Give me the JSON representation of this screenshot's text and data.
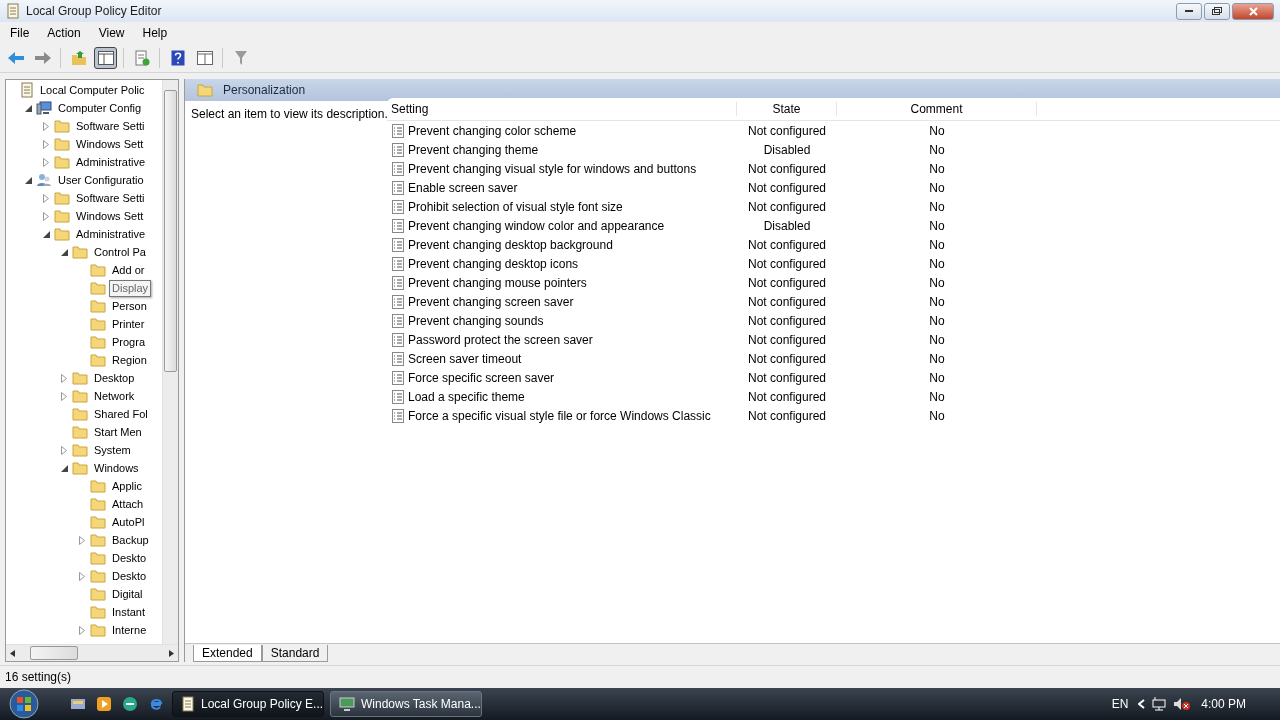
{
  "window": {
    "title": "Local Group Policy Editor"
  },
  "menu": [
    "File",
    "Action",
    "View",
    "Help"
  ],
  "toolbar": [
    [
      {
        "kind": "back",
        "pressed": false
      },
      {
        "kind": "forward",
        "pressed": false
      }
    ],
    [
      {
        "kind": "up",
        "pressed": false
      },
      {
        "kind": "tree",
        "pressed": true
      }
    ],
    [
      {
        "kind": "export",
        "pressed": false
      }
    ],
    [
      {
        "kind": "help",
        "pressed": false
      },
      {
        "kind": "view",
        "pressed": false
      }
    ],
    [
      {
        "kind": "filter",
        "pressed": false
      }
    ]
  ],
  "tree": [
    {
      "label": "Local Computer Polic",
      "kind": "root",
      "hovered": false,
      "children": [
        {
          "label": "Computer Config",
          "kind": "computer",
          "expanded": true,
          "hovered": false,
          "children": [
            {
              "label": "Software Setti",
              "kind": "folder",
              "expanded": false,
              "hovered": false
            },
            {
              "label": "Windows Sett",
              "kind": "folder",
              "expanded": false,
              "hovered": false
            },
            {
              "label": "Administrative",
              "kind": "folder",
              "expanded": false,
              "hovered": false
            }
          ]
        },
        {
          "label": "User Configuratio",
          "kind": "user",
          "expanded": true,
          "hovered": false,
          "children": [
            {
              "label": "Software Setti",
              "kind": "folder",
              "expanded": false,
              "hovered": false
            },
            {
              "label": "Windows Sett",
              "kind": "folder",
              "expanded": false,
              "hovered": false
            },
            {
              "label": "Administrative",
              "kind": "folder",
              "expanded": true,
              "hovered": false,
              "children": [
                {
                  "label": "Control Pa",
                  "kind": "folder",
                  "expanded": true,
                  "hovered": false,
                  "children": [
                    {
                      "label": "Add or",
                      "kind": "folder",
                      "hovered": false
                    },
                    {
                      "label": "Display",
                      "kind": "folder",
                      "hovered": true
                    },
                    {
                      "label": "Person",
                      "kind": "folder",
                      "hovered": false
                    },
                    {
                      "label": "Printer",
                      "kind": "folder",
                      "hovered": false
                    },
                    {
                      "label": "Progra",
                      "kind": "folder",
                      "hovered": false
                    },
                    {
                      "label": "Region",
                      "kind": "folder",
                      "hovered": false
                    }
                  ]
                },
                {
                  "label": "Desktop",
                  "kind": "folder",
                  "expanded": false,
                  "hovered": false
                },
                {
                  "label": "Network",
                  "kind": "folder",
                  "expanded": false,
                  "hovered": false
                },
                {
                  "label": "Shared Fol",
                  "kind": "folder",
                  "hovered": false
                },
                {
                  "label": "Start Men",
                  "kind": "folder",
                  "hovered": false
                },
                {
                  "label": "System",
                  "kind": "folder",
                  "expanded": false,
                  "hovered": false
                },
                {
                  "label": "Windows",
                  "kind": "folder",
                  "expanded": true,
                  "hovered": false,
                  "children": [
                    {
                      "label": "Applic",
                      "kind": "folder",
                      "hovered": false
                    },
                    {
                      "label": "Attach",
                      "kind": "folder",
                      "hovered": false
                    },
                    {
                      "label": "AutoPl",
                      "kind": "folder",
                      "hovered": false
                    },
                    {
                      "label": "Backup",
                      "kind": "folder",
                      "expanded": false,
                      "hovered": false
                    },
                    {
                      "label": "Deskto",
                      "kind": "folder",
                      "hovered": false
                    },
                    {
                      "label": "Deskto",
                      "kind": "folder",
                      "expanded": false,
                      "hovered": false
                    },
                    {
                      "label": "Digital",
                      "kind": "folder",
                      "hovered": false
                    },
                    {
                      "label": "Instant",
                      "kind": "folder",
                      "hovered": false
                    },
                    {
                      "label": "Interne",
                      "kind": "folder",
                      "expanded": false,
                      "hovered": false
                    }
                  ]
                }
              ]
            }
          ]
        }
      ]
    }
  ],
  "details": {
    "title": "Personalization",
    "description": "Select an item to view its description.",
    "columns": [
      "Setting",
      "State",
      "Comment"
    ],
    "rows": [
      {
        "setting": "Prevent changing color scheme",
        "state": "Not configured",
        "comment": "No"
      },
      {
        "setting": "Prevent changing theme",
        "state": "Disabled",
        "comment": "No"
      },
      {
        "setting": "Prevent changing visual style for windows and buttons",
        "state": "Not configured",
        "comment": "No"
      },
      {
        "setting": "Enable screen saver",
        "state": "Not configured",
        "comment": "No"
      },
      {
        "setting": "Prohibit selection of visual style font size",
        "state": "Not configured",
        "comment": "No"
      },
      {
        "setting": "Prevent changing window color and appearance",
        "state": "Disabled",
        "comment": "No"
      },
      {
        "setting": "Prevent changing desktop background",
        "state": "Not configured",
        "comment": "No"
      },
      {
        "setting": "Prevent changing desktop icons",
        "state": "Not configured",
        "comment": "No"
      },
      {
        "setting": "Prevent changing mouse pointers",
        "state": "Not configured",
        "comment": "No"
      },
      {
        "setting": "Prevent changing screen saver",
        "state": "Not configured",
        "comment": "No"
      },
      {
        "setting": "Prevent changing sounds",
        "state": "Not configured",
        "comment": "No"
      },
      {
        "setting": "Password protect the screen saver",
        "state": "Not configured",
        "comment": "No"
      },
      {
        "setting": "Screen saver timeout",
        "state": "Not configured",
        "comment": "No"
      },
      {
        "setting": "Force specific screen saver",
        "state": "Not configured",
        "comment": "No"
      },
      {
        "setting": "Load a specific theme",
        "state": "Not configured",
        "comment": "No"
      },
      {
        "setting": "Force a specific visual style file or force Windows Classic",
        "state": "Not configured",
        "comment": "No"
      }
    ],
    "tabs": [
      {
        "label": "Extended",
        "selected": true
      },
      {
        "label": "Standard",
        "selected": false
      }
    ]
  },
  "status_bar": "16 setting(s)",
  "taskbar": {
    "tasks": [
      {
        "label": "Local Group Policy E...",
        "kind": "policy",
        "selected": true
      },
      {
        "label": "Windows Task Mana...",
        "kind": "taskmgr",
        "selected": false
      }
    ],
    "language": "EN",
    "clock": "4:00 PM"
  }
}
